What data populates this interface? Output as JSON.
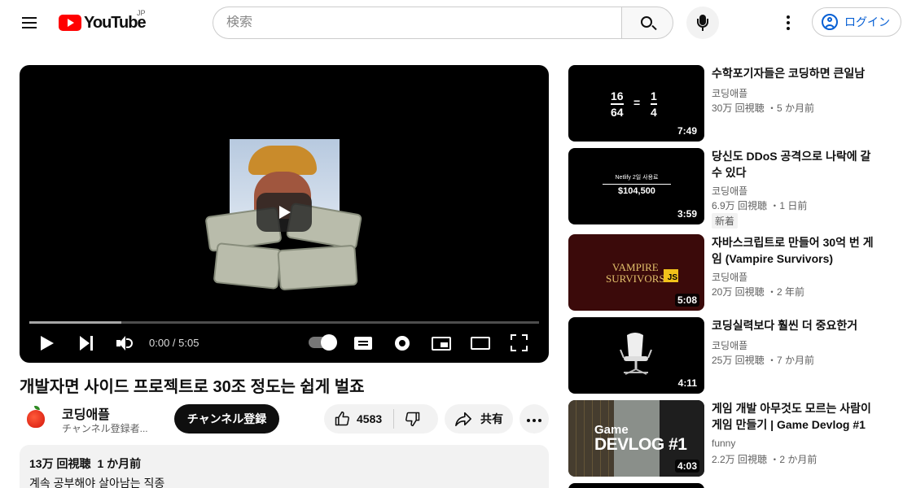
{
  "header": {
    "logo_text": "YouTube",
    "country_code": "JP",
    "search_placeholder": "検索",
    "login_label": "ログイン"
  },
  "player": {
    "time": "0:00 / 5:05",
    "progress": 0.0,
    "loaded": 0.18
  },
  "video": {
    "title": "개발자면 사이드 프로젝트로 30조 정도는 쉽게 벌죠",
    "channel": "코딩애플",
    "subscribers": "チャンネル登録者...",
    "subscribe_label": "チャンネル登録",
    "likes": "4583",
    "share_label": "共有",
    "views": "13万 回視聴",
    "age": "1 か月前",
    "description": "계속 공부해야 살아남는 직종"
  },
  "recommendations": [
    {
      "title": "수학포기자들은 코딩하면 큰일남",
      "channel": "코딩애플",
      "meta": "30万 回視聴 ・5 か月前",
      "duration": "7:49",
      "thumb_num1": "16",
      "thumb_den1": "64",
      "thumb_eq": "=",
      "thumb_num2": "1",
      "thumb_den2": "4"
    },
    {
      "title": "당신도 DDoS 공격으로 나락에 갈 수 있다",
      "channel": "코딩애플",
      "meta": "6.9万 回視聴 ・1 日前",
      "badge": "新着",
      "duration": "3:59",
      "thumb_caption": "Netlify 2일 사용료",
      "thumb_amount": "$104,500"
    },
    {
      "title": "자바스크립트로 만들어 30억 번 게임 (Vampire Survivors)",
      "channel": "코딩애플",
      "meta": "20万 回視聴 ・2 年前",
      "duration": "5:08",
      "thumb_line1": "VAMPIRE",
      "thumb_line2": "SURVIVORS",
      "thumb_js": "JS"
    },
    {
      "title": "코딩실력보다 훨씬 더 중요한거",
      "channel": "코딩애플",
      "meta": "25万 回視聴 ・7 か月前",
      "duration": "4:11"
    },
    {
      "title": "게임 개발 아무것도 모르는 사람이 게임 만들기 | Game Devlog #1",
      "channel": "funny",
      "meta": "2.2万 回視聴 ・2 か月前",
      "duration": "4:03",
      "thumb_line1": "Game",
      "thumb_line2": "DEVLOG #1"
    }
  ],
  "colors": {
    "brand_red": "#ff0000",
    "link_blue": "#065fd4"
  }
}
